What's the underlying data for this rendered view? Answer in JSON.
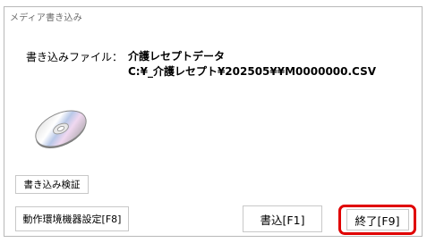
{
  "window": {
    "title": "メディア書き込み"
  },
  "file": {
    "label": "書き込みファイル：",
    "name": "介護レセプトデータ",
    "path": "C:¥_介護レセプト¥202505¥¥M0000000.CSV"
  },
  "icons": {
    "disc": "cd-disc-icon"
  },
  "buttons": {
    "verify": "書き込み検証",
    "settings": "動作環境機器設定[F8]",
    "write": "書込[F1]",
    "end": "終了[F9]"
  },
  "colors": {
    "highlight": "#e00000",
    "border": "#c8c8c8"
  }
}
